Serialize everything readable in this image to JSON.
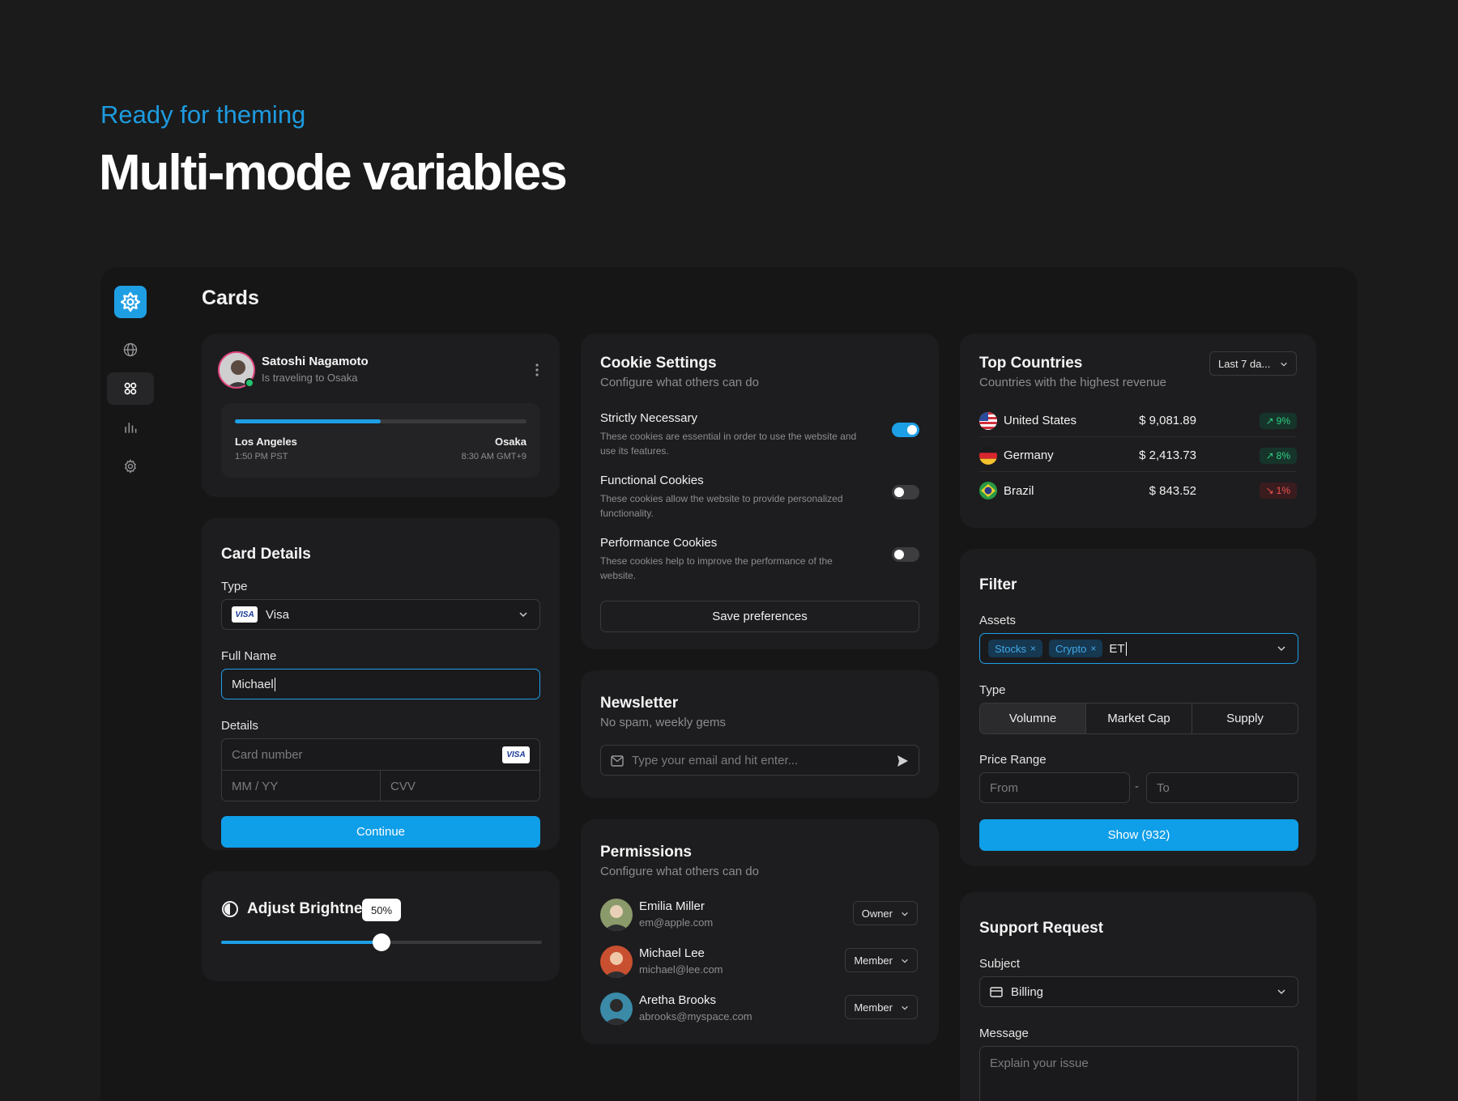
{
  "hero": {
    "subtitle": "Ready for theming",
    "title": "Multi-mode variables"
  },
  "page": {
    "title": "Cards"
  },
  "colors": {
    "accent": "#0f9ee8",
    "background": "#1b1b1c",
    "card": "#1d1d1f",
    "success": "#2fcf82",
    "danger": "#f0524f"
  },
  "sidebar": {
    "items": [
      {
        "icon": "globe-icon",
        "active": false
      },
      {
        "icon": "grid-icon",
        "active": true
      },
      {
        "icon": "bar-chart-icon",
        "active": false
      },
      {
        "icon": "gear-icon",
        "active": false
      }
    ]
  },
  "trip": {
    "name": "Satoshi Nagamoto",
    "status": "Is traveling to Osaka",
    "progress": 0.5,
    "from_city": "Los Angeles",
    "from_time": "1:50 PM PST",
    "to_city": "Osaka",
    "to_time": "8:30 AM GMT+9"
  },
  "card_details": {
    "title": "Card Details",
    "type_label": "Type",
    "type_value": "Visa",
    "visa_badge": "VISA",
    "full_name_label": "Full Name",
    "full_name_value": "Michael",
    "details_label": "Details",
    "card_number_placeholder": "Card number",
    "expiry_placeholder": "MM / YY",
    "cvv_placeholder": "CVV",
    "continue_label": "Continue"
  },
  "brightness": {
    "title": "Adjust Brightness",
    "value_label": "50%",
    "value": 0.5
  },
  "cookies": {
    "title": "Cookie Settings",
    "subtitle": "Configure what others can do",
    "items": [
      {
        "title": "Strictly Necessary",
        "desc": "These cookies are essential in order to use the website and use its features.",
        "enabled": true
      },
      {
        "title": "Functional Cookies",
        "desc": "These cookies allow the website to provide personalized functionality.",
        "enabled": false
      },
      {
        "title": "Performance Cookies",
        "desc": "These cookies help to improve the performance of the website.",
        "enabled": false
      }
    ],
    "save_label": "Save preferences"
  },
  "newsletter": {
    "title": "Newsletter",
    "subtitle": "No spam, weekly gems",
    "placeholder": "Type your email and hit enter..."
  },
  "permissions": {
    "title": "Permissions",
    "subtitle": "Configure what others can do",
    "users": [
      {
        "name": "Emilia Miller",
        "email": "em@apple.com",
        "role": "Owner"
      },
      {
        "name": "Michael Lee",
        "email": "michael@lee.com",
        "role": "Member"
      },
      {
        "name": "Aretha Brooks",
        "email": "abrooks@myspace.com",
        "role": "Member"
      }
    ]
  },
  "top_countries": {
    "title": "Top Countries",
    "subtitle": "Countries with the highest revenue",
    "range_label": "Last 7 da...",
    "rows": [
      {
        "country": "United States",
        "amount": "$ 9,081.89",
        "change": "9%",
        "direction": "up"
      },
      {
        "country": "Germany",
        "amount": "$ 2,413.73",
        "change": "8%",
        "direction": "up"
      },
      {
        "country": "Brazil",
        "amount": "$ 843.52",
        "change": "1%",
        "direction": "down"
      }
    ]
  },
  "filter": {
    "title": "Filter",
    "assets_label": "Assets",
    "chips": [
      "Stocks",
      "Crypto"
    ],
    "assets_query": "ET",
    "type_label": "Type",
    "types": [
      "Volumne",
      "Market Cap",
      "Supply"
    ],
    "active_type": "Volumne",
    "price_label": "Price Range",
    "from_placeholder": "From",
    "to_placeholder": "To",
    "range_separator": "-",
    "show_label": "Show (932)"
  },
  "support": {
    "title": "Support Request",
    "subject_label": "Subject",
    "subject_value": "Billing",
    "message_label": "Message",
    "message_placeholder": "Explain your issue"
  }
}
